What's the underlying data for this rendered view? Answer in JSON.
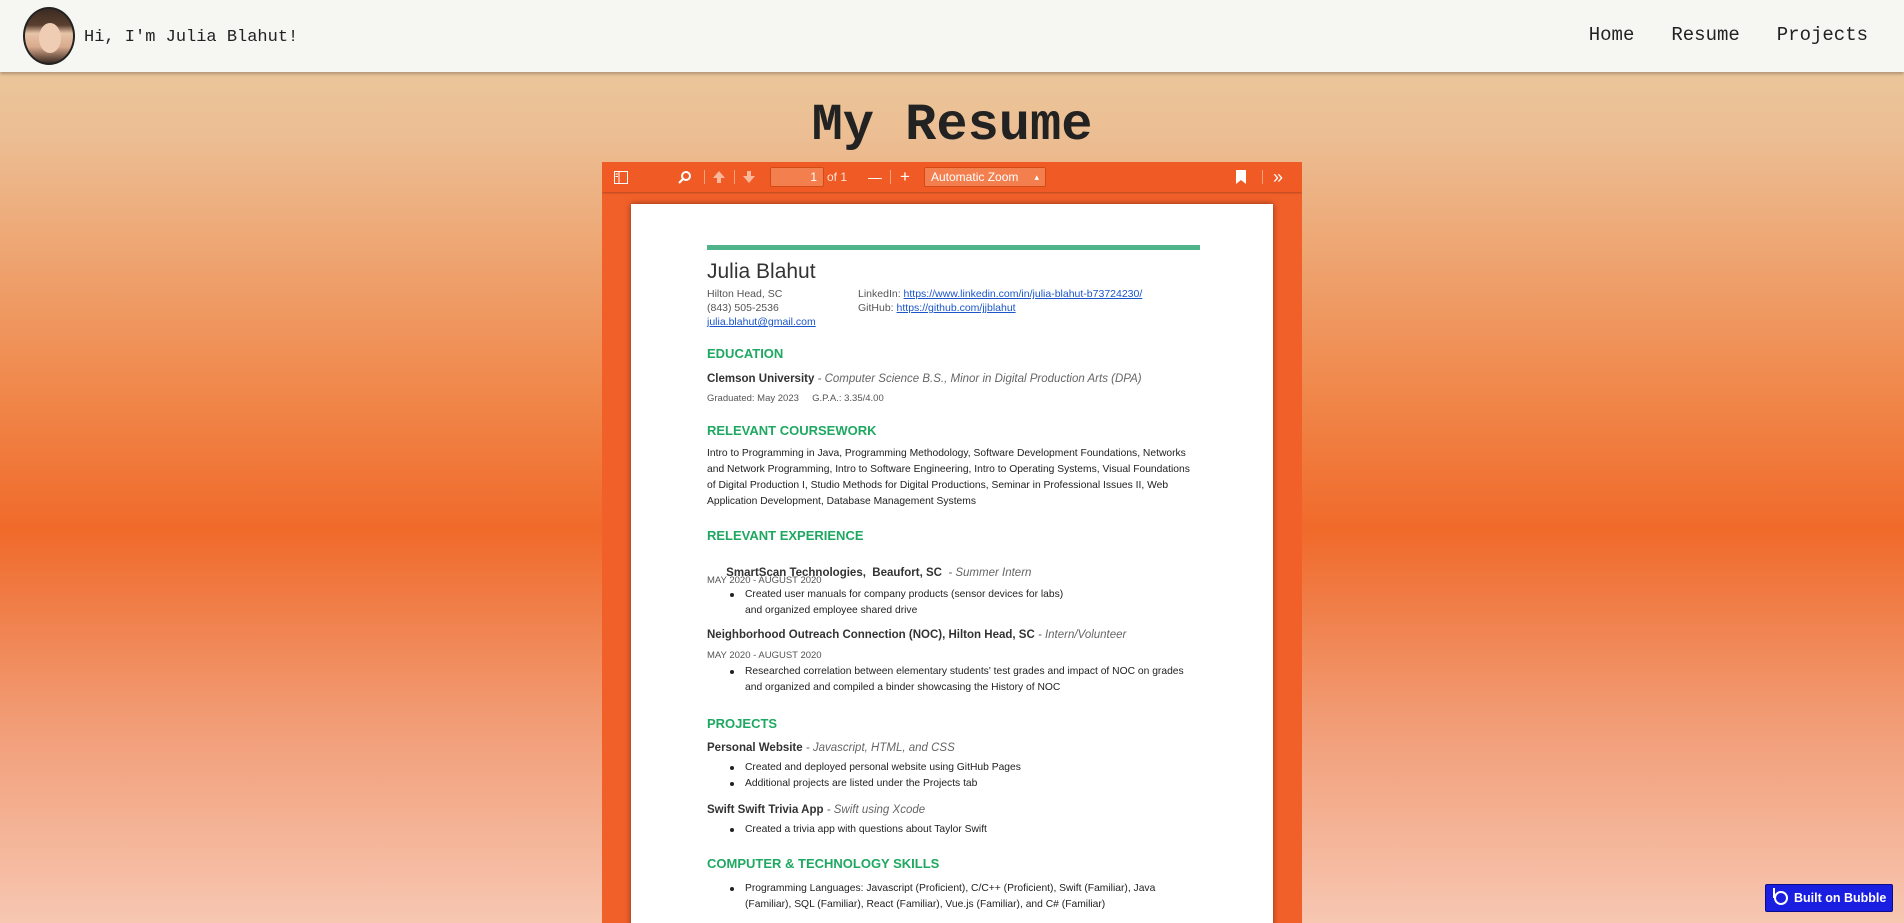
{
  "header": {
    "greeting": "Hi, I'm Julia Blahut!",
    "nav": [
      "Home",
      "Resume",
      "Projects"
    ]
  },
  "page_title": "My Resume",
  "pdf_toolbar": {
    "page_number": "1",
    "of_pages": "of 1",
    "zoom": "Automatic Zoom",
    "zoom_out": "—",
    "zoom_in": "+",
    "more": "»"
  },
  "resume": {
    "name": "Julia Blahut",
    "location": "Hilton Head, SC",
    "phone": "(843) 505-2536",
    "email": "julia.blahut@gmail.com",
    "linkedin_label": "LinkedIn:",
    "linkedin_url": "https://www.linkedin.com/in/julia-blahut-b73724230/",
    "github_label": "GitHub:",
    "github_url": "https://github.com/jjblahut",
    "education": {
      "heading": "EDUCATION",
      "school": "Clemson University",
      "degree": " - Computer Science B.S., Minor in Digital Production Arts (DPA)",
      "details": "Graduated: May 2023     G.P.A.: 3.35/4.00"
    },
    "coursework": {
      "heading": "RELEVANT COURSEWORK",
      "text": "Intro to Programming in Java, Programming Methodology, Software Development Foundations, Networks and Network Programming, Intro to Software Engineering, Intro to Operating Systems, Visual Foundations of Digital Production I, Studio Methods for Digital Productions, Seminar in Professional Issues II, Web Application Development, Database Management Systems"
    },
    "experience": {
      "heading": "RELEVANT EXPERIENCE",
      "jobs": [
        {
          "org": "SmartScan Technologies,  Beaufort, SC",
          "role": "  - Summer Intern",
          "dates": "MAY 2020 - AUGUST 2020",
          "bullets": [
            "Created user manuals for company products (sensor devices for labs)\nand organized employee shared drive"
          ]
        },
        {
          "org": "Neighborhood Outreach Connection (NOC), Hilton Head, SC",
          "role": " - Intern/Volunteer",
          "dates": "MAY 2020 - AUGUST 2020",
          "bullets": [
            "Researched correlation between elementary students' test grades and impact of NOC on grades and organized and compiled a binder showcasing the History of NOC"
          ]
        }
      ]
    },
    "projects": {
      "heading": "PROJECTS",
      "items": [
        {
          "name": "Personal Website",
          "tech": " - Javascript, HTML, and CSS",
          "bullets": [
            "Created and deployed personal website using GitHub Pages",
            "Additional projects are listed under the Projects tab"
          ]
        },
        {
          "name": "Swift Swift Trivia App",
          "tech": " - Swift using Xcode",
          "bullets": [
            "Created a trivia app with questions about Taylor Swift"
          ]
        }
      ]
    },
    "skills": {
      "heading": "COMPUTER & TECHNOLOGY SKILLS",
      "bullets": [
        "Programming Languages: Javascript (Proficient), C/C++ (Proficient), Swift (Familiar), Java (Familiar), SQL (Familiar), React (Familiar), Vue.js (Familiar), and C# (Familiar)"
      ]
    }
  },
  "bubble_badge": "Built on Bubble"
}
